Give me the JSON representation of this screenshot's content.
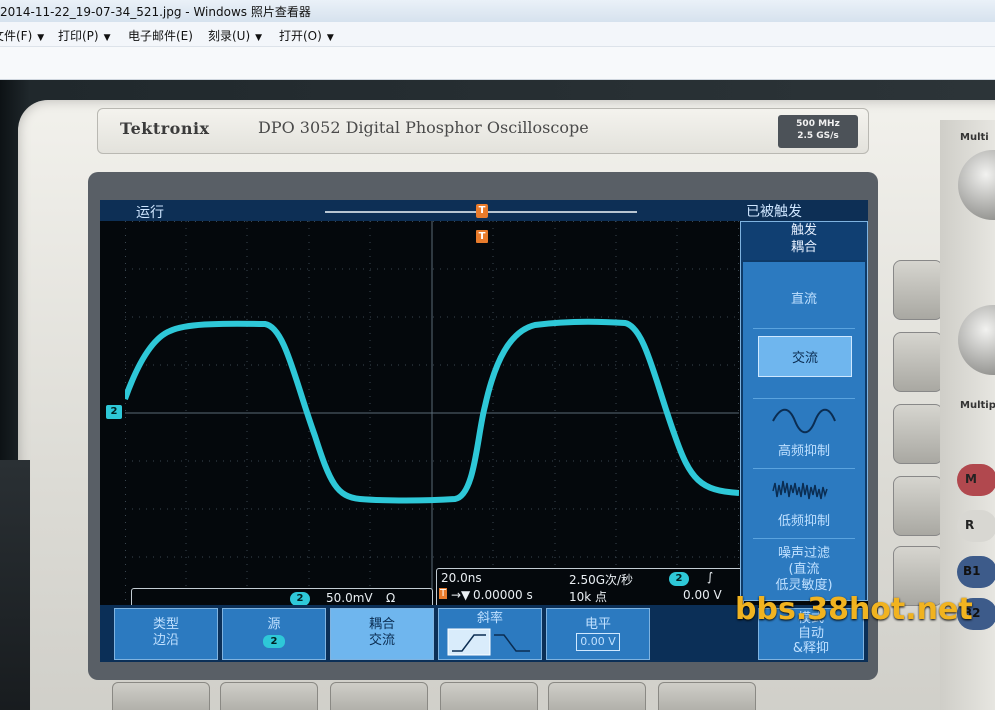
{
  "window": {
    "title": "2014-11-22_19-07-34_521.jpg - Windows 照片查看器"
  },
  "menu": {
    "items": [
      {
        "label": "文件(F)"
      },
      {
        "label": "打印(P)"
      },
      {
        "label": "电子邮件(E)"
      },
      {
        "label": "刻录(U)"
      },
      {
        "label": "打开(O)"
      }
    ]
  },
  "photo": {
    "brand": "Tektronix",
    "model": "DPO 3052 Digital Phosphor Oscilloscope",
    "spec_line1": "500 MHz",
    "spec_line2": "2.5 GS/s",
    "side_label_top": "Multi",
    "side_label_mid": "Multip",
    "color_buttons": [
      "M",
      "R",
      "B1",
      "B2"
    ],
    "watermark": "bbs.38hot.net"
  },
  "scope": {
    "status": "运行",
    "trigger_state": "已被触发",
    "trigger_marker": "T",
    "channel": "2",
    "volts_per_div": "50.0mV",
    "input_symbol": "Ω",
    "time_per_div": "20.0ns",
    "trigger_delay": "0.00000 s",
    "sample_rate": "2.50G次/秒",
    "record_length": "10k 点",
    "trigger_level": "0.00 V",
    "slope_symbol": "∫",
    "side_menu": {
      "title_line1": "触发",
      "title_line2": "耦合",
      "options": [
        {
          "label": "直流",
          "selected": false
        },
        {
          "label": "交流",
          "selected": true
        },
        {
          "label": "高频抑制",
          "selected": false
        },
        {
          "label": "低频抑制",
          "selected": false
        },
        {
          "label_line1": "噪声过滤",
          "label_line2": "(直流",
          "label_line3": "低灵敏度)",
          "selected": false
        }
      ]
    },
    "bottom_menu": {
      "type_label": "类型",
      "type_value": "边沿",
      "source_label": "源",
      "source_value": "2",
      "coupling_label": "耦合",
      "coupling_value": "交流",
      "slope_label": "斜率",
      "level_label": "电平",
      "level_value": "0.00 V",
      "mode_label": "模式",
      "mode_value": "自动",
      "mode_value2": "&释抑"
    },
    "accent": "#2ec8d8"
  }
}
